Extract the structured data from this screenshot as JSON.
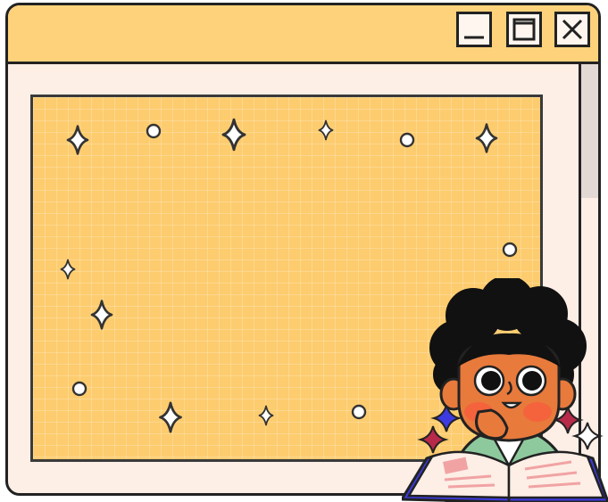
{
  "window": {
    "controls": {
      "minimize_icon": "minimize-icon",
      "maximize_icon": "maximize-icon",
      "close_icon": "close-icon"
    }
  },
  "colors": {
    "titlebar": "#fdd27a",
    "window_bg": "#fdeee6",
    "canvas_bg": "#fdcc6e",
    "outline": "#222222",
    "accent_blue": "#3d3be0",
    "accent_red": "#b82a4a"
  },
  "decorations": {
    "sparkle_icon": "sparkle-icon",
    "circle_icon": "circle-icon"
  },
  "illustration": {
    "subject": "character-reading-book"
  }
}
